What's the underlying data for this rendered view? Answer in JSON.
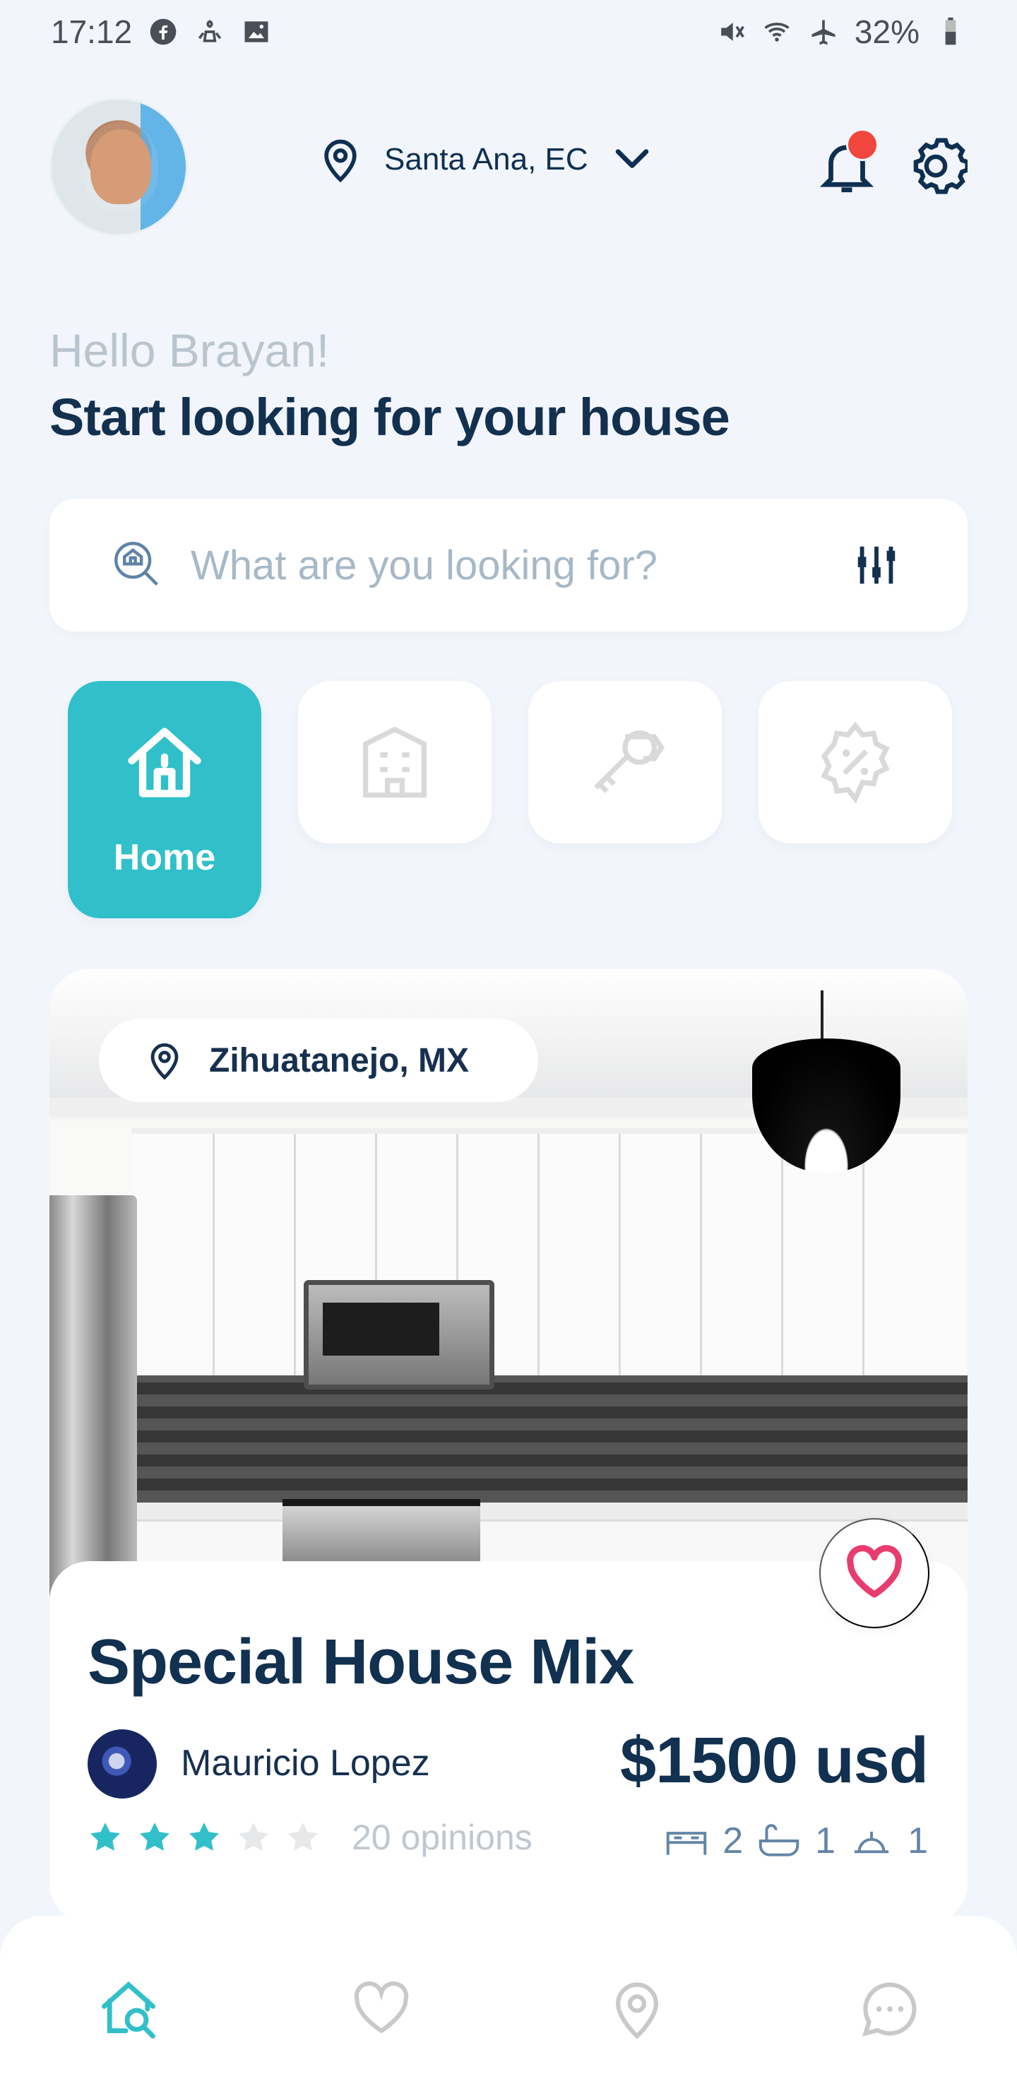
{
  "status": {
    "time": "17:12",
    "battery": "32%"
  },
  "header": {
    "location": "Santa Ana, EC"
  },
  "greeting": "Hello Brayan!",
  "headline": "Start looking for your house",
  "search": {
    "placeholder": "What are you looking for?"
  },
  "categories": [
    {
      "label": "Home",
      "active": true
    },
    {
      "label": ""
    },
    {
      "label": ""
    },
    {
      "label": ""
    }
  ],
  "property": {
    "location": "Zihuatanejo, MX",
    "title": "Special House Mix",
    "host": "Mauricio Lopez",
    "price": "$1500 usd",
    "rating": 3,
    "opinions": "20 opinions",
    "features": {
      "bedrooms": "2",
      "bathrooms": "1",
      "kitchen": "1"
    }
  },
  "colors": {
    "primary": "#31c0c9",
    "text": "#12304f",
    "favorite": "#e83c6e",
    "notification": "#f0463d"
  }
}
